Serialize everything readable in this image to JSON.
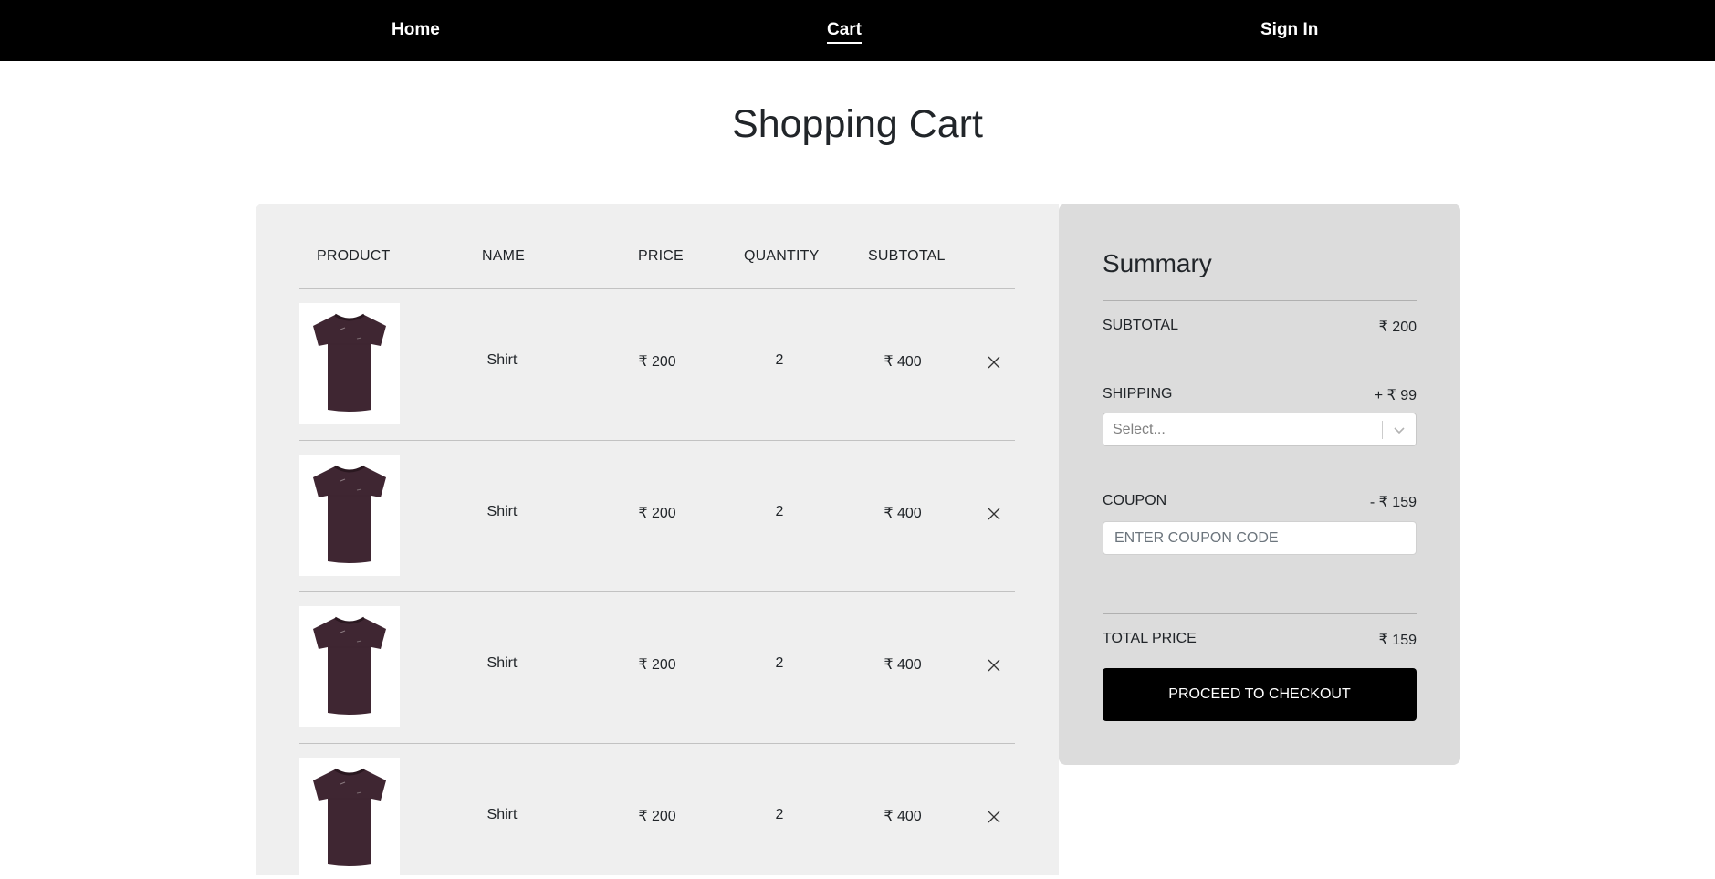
{
  "nav": {
    "home": "Home",
    "cart": "Cart",
    "signin": "Sign In"
  },
  "page": {
    "title": "Shopping Cart"
  },
  "cart": {
    "headers": {
      "product": "PRODUCT",
      "name": "NAME",
      "price": "PRICE",
      "quantity": "QUANTITY",
      "subtotal": "SUBTOTAL"
    },
    "items": [
      {
        "name": "Shirt",
        "price": "₹ 200",
        "quantity": "2",
        "subtotal": "₹ 400",
        "image": "tshirt-image"
      },
      {
        "name": "Shirt",
        "price": "₹ 200",
        "quantity": "2",
        "subtotal": "₹ 400",
        "image": "tshirt-image"
      },
      {
        "name": "Shirt",
        "price": "₹ 200",
        "quantity": "2",
        "subtotal": "₹ 400",
        "image": "tshirt-image"
      },
      {
        "name": "Shirt",
        "price": "₹ 200",
        "quantity": "2",
        "subtotal": "₹ 400",
        "image": "tshirt-image"
      }
    ],
    "remove_icon": "close-icon"
  },
  "summary": {
    "title": "Summary",
    "subtotal_label": "SUBTOTAL",
    "subtotal_value": "₹ 200",
    "shipping_label": "SHIPPING",
    "shipping_value": "+ ₹ 99",
    "shipping_select_placeholder": "Select...",
    "coupon_label": "COUPON",
    "coupon_value": "- ₹ 159",
    "coupon_placeholder": "ENTER COUPON CODE",
    "total_label": "TOTAL PRICE",
    "total_value": "₹ 159",
    "checkout_label": "PROCEED TO CHECKOUT"
  },
  "colors": {
    "navbar": "#000000",
    "cart_panel": "#efefef",
    "summary_panel": "#dcdcdc",
    "shirt": "#3f2632",
    "button": "#000000"
  }
}
